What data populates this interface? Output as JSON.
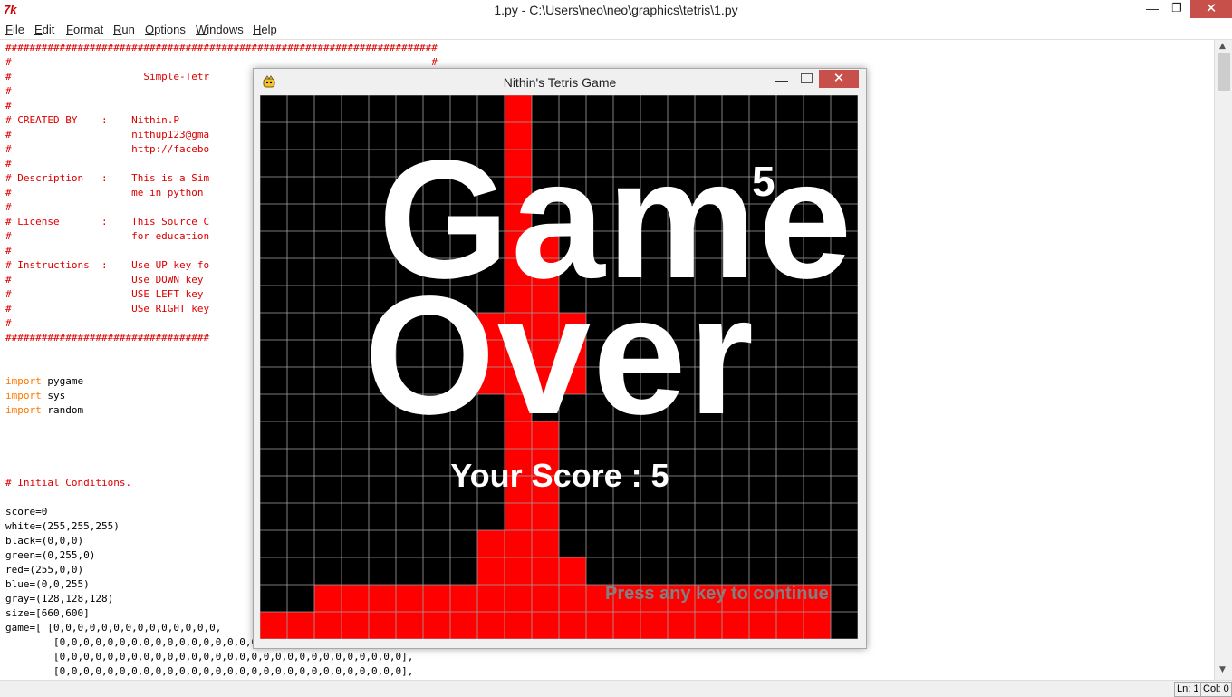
{
  "window": {
    "title": "1.py - C:\\Users\\neo\\neo\\graphics\\tetris\\1.py",
    "icon_label": "7k",
    "controls": {
      "minimize": "—",
      "maximize": "❐",
      "close": "✕"
    }
  },
  "menu": [
    {
      "label": "File",
      "u": "F",
      "rest": "ile"
    },
    {
      "label": "Edit",
      "u": "E",
      "rest": "dit"
    },
    {
      "label": "Format",
      "u": "F",
      "rest": "ormat"
    },
    {
      "label": "Run",
      "u": "R",
      "rest": "un"
    },
    {
      "label": "Options",
      "u": "O",
      "rest": "ptions"
    },
    {
      "label": "Windows",
      "u": "W",
      "rest": "indows"
    },
    {
      "label": "Help",
      "u": "H",
      "rest": "elp"
    }
  ],
  "code_lines": [
    {
      "t": "########################################################################",
      "c": "cmt"
    },
    {
      "t": "#                                                                      #",
      "c": "cmt"
    },
    {
      "t": "#                      Simple-Tetr",
      "c": "cmt"
    },
    {
      "t": "#",
      "c": "cmt"
    },
    {
      "t": "#",
      "c": "cmt"
    },
    {
      "t": "# CREATED BY    :    Nithin.P",
      "c": "cmt"
    },
    {
      "t": "#                    nithup123@gma",
      "c": "cmt"
    },
    {
      "t": "#                    http://facebo",
      "c": "cmt"
    },
    {
      "t": "#",
      "c": "cmt"
    },
    {
      "t": "# Description   :    This is a Sim",
      "c": "cmt"
    },
    {
      "t": "#                    me in python",
      "c": "cmt"
    },
    {
      "t": "#",
      "c": "cmt"
    },
    {
      "t": "# License       :    This Source C",
      "c": "cmt"
    },
    {
      "t": "#                    for education",
      "c": "cmt"
    },
    {
      "t": "#",
      "c": "cmt"
    },
    {
      "t": "# Instructions  :    Use UP key fo",
      "c": "cmt"
    },
    {
      "t": "#                    Use DOWN key",
      "c": "cmt"
    },
    {
      "t": "#                    USE LEFT key",
      "c": "cmt"
    },
    {
      "t": "#                    USe RIGHT key",
      "c": "cmt"
    },
    {
      "t": "#",
      "c": "cmt"
    },
    {
      "t": "##################################",
      "c": "cmt"
    },
    {
      "t": "",
      "c": ""
    },
    {
      "t": "",
      "c": ""
    },
    {
      "kw": "import",
      "t": " pygame"
    },
    {
      "kw": "import",
      "t": " sys"
    },
    {
      "kw": "import",
      "t": " random"
    },
    {
      "t": "",
      "c": ""
    },
    {
      "t": "",
      "c": ""
    },
    {
      "t": "",
      "c": ""
    },
    {
      "t": "",
      "c": ""
    },
    {
      "t": "# Initial Conditions.",
      "c": "cmt"
    },
    {
      "t": "",
      "c": ""
    },
    {
      "t": "score=0",
      "c": ""
    },
    {
      "t": "white=(255,255,255)",
      "c": ""
    },
    {
      "t": "black=(0,0,0)",
      "c": ""
    },
    {
      "t": "green=(0,255,0)",
      "c": ""
    },
    {
      "t": "red=(255,0,0)",
      "c": ""
    },
    {
      "t": "blue=(0,0,255)",
      "c": ""
    },
    {
      "t": "gray=(128,128,128)",
      "c": ""
    },
    {
      "t": "size=[660,600]",
      "c": ""
    },
    {
      "t": "game=[ [0,0,0,0,0,0,0,0,0,0,0,0,0,0,",
      "c": ""
    },
    {
      "t": "        [0,0,0,0,0,0,0,0,0,0,0,0,0,0,0,0,0,0,0,0,0,0,0,0,0,0,0,0,0],",
      "c": ""
    },
    {
      "t": "        [0,0,0,0,0,0,0,0,0,0,0,0,0,0,0,0,0,0,0,0,0,0,0,0,0,0,0,0,0],",
      "c": ""
    },
    {
      "t": "        [0,0,0,0,0,0,0,0,0,0,0,0,0,0,0,0,0,0,0,0,0,0,0,0,0,0,0,0,0],",
      "c": ""
    }
  ],
  "status": {
    "ln": "Ln: 1",
    "col": "Col: 0"
  },
  "game_window": {
    "title": "Nithin's Tetris Game",
    "controls": {
      "minimize": "—",
      "close": "✕"
    }
  },
  "game": {
    "colors": {
      "filled": "#ff0000",
      "empty": "#000000",
      "grid": "#a0a0a0"
    },
    "grid": [
      "000000000100000000000",
      "000000000100000000000",
      "000000000100000000000",
      "000000000100000000000",
      "000000000100000000000",
      "000000000110000000000",
      "000000000110000000000",
      "000000000110000000000",
      "000000001111000000000",
      "000000001111000000000",
      "000000001111000000000",
      "000000000100000000000",
      "000000000110000000000",
      "000000000110000000000",
      "000000000110000000000",
      "000000000110000000000",
      "000000001110000000000",
      "000000001111000000000",
      "001111111111111111111",
      "111111111111111111111"
    ],
    "game_text": "Game",
    "over_text": "Over",
    "overlay_digit": "5",
    "score_text": "Your Score : 5",
    "continue_text": "Press any key to continue"
  }
}
